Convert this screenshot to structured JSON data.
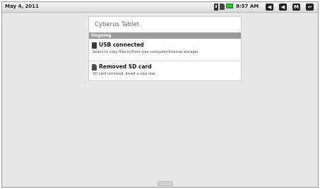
{
  "status_bar": {
    "date": "May 4, 2011",
    "time": "8:57 AM",
    "icons": [
      "usb-icon",
      "sd-card-icon",
      "battery-icon"
    ],
    "nav_buttons": [
      {
        "name": "volume-down-button",
        "glyph": "◀"
      },
      {
        "name": "volume-up-button",
        "glyph": "◀"
      },
      {
        "name": "menu-button",
        "glyph": "M"
      },
      {
        "name": "back-button",
        "glyph": "↩"
      }
    ]
  },
  "notification_panel": {
    "title": "Cyberus Tablet",
    "section": "Ongoing",
    "items": [
      {
        "icon": "usb-icon",
        "title": "USB connected",
        "description": "Select to copy files to/from your computer(Internal storage)."
      },
      {
        "icon": "sd-card-icon",
        "title": "Removed SD card",
        "description": "SD card removed. Insert a new one."
      }
    ]
  },
  "colors": {
    "background": "#e7e7e7",
    "section_header": "#9b9b9b",
    "battery": "#2fbd2f"
  }
}
